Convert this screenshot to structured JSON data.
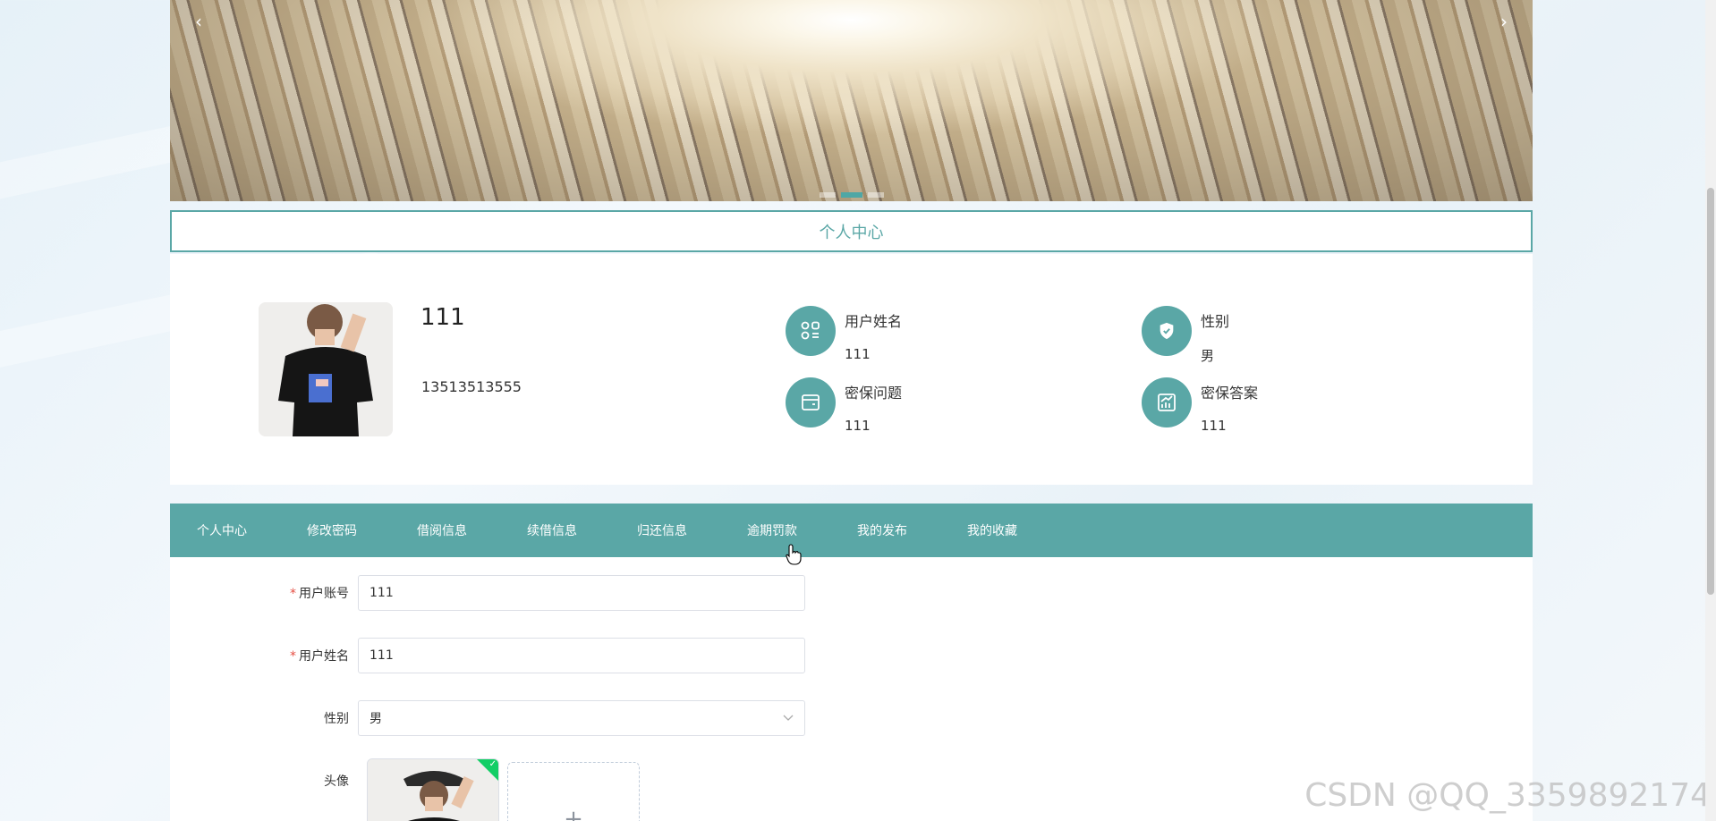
{
  "banner": {
    "prev_icon": "chevron-left-icon",
    "next_icon": "chevron-right-icon",
    "prev_glyph": "‹",
    "next_glyph": "›",
    "active_slide": 1,
    "slide_count": 3
  },
  "section_title": "个人中心",
  "profile": {
    "name": "111",
    "phone": "13513513555",
    "fields": [
      {
        "label": "用户姓名",
        "value": "111",
        "icon": "apps-list-icon"
      },
      {
        "label": "性别",
        "value": "男",
        "icon": "shield-check-icon"
      },
      {
        "label": "密保问题",
        "value": "111",
        "icon": "wallet-card-icon"
      },
      {
        "label": "密保答案",
        "value": "111",
        "icon": "chart-trend-icon"
      }
    ]
  },
  "tabs": [
    "个人中心",
    "修改密码",
    "借阅信息",
    "续借信息",
    "归还信息",
    "逾期罚款",
    "我的发布",
    "我的收藏"
  ],
  "form": {
    "required_mark": "*",
    "account_label": "用户账号",
    "account_value": "111",
    "name_label": "用户姓名",
    "name_value": "111",
    "gender_label": "性别",
    "gender_value": "男",
    "avatar_label": "头像",
    "upload_add_glyph": "+"
  },
  "watermark": "CSDN @QQ_3359892174",
  "colors": {
    "primary": "#5aa7a6",
    "required": "#e54d42",
    "success": "#13ce66"
  }
}
